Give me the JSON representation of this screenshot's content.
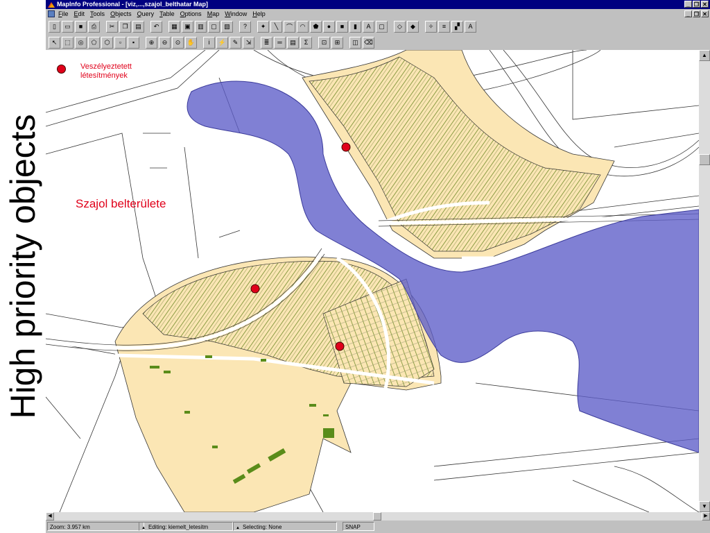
{
  "slide": {
    "side_text": "High priority objects"
  },
  "window": {
    "title": "MapInfo Professional - [viz,...,szajol_belthatar Map]",
    "controls": [
      "_",
      "❐",
      "✕"
    ]
  },
  "menu": [
    "File",
    "Edit",
    "Tools",
    "Objects",
    "Query",
    "Table",
    "Options",
    "Map",
    "Window",
    "Help"
  ],
  "toolbar1": [
    "new-icon",
    "open-icon",
    "save-icon",
    "print-icon",
    "cut-icon",
    "copy-icon",
    "paste-icon",
    "undo-icon",
    "browser-icon",
    "map-icon",
    "graph-icon",
    "layout-icon",
    "redistrict-icon",
    "help-icon",
    "symbol-icon",
    "line-icon",
    "polyline-icon",
    "arc-icon",
    "polygon-icon",
    "ellipse-icon",
    "rectangle-icon",
    "rounded-rect-icon",
    "text-icon",
    "frame-icon",
    "reshape-icon",
    "add-node-icon",
    "symbol-style-icon",
    "line-style-icon",
    "region-style-icon",
    "text-style-icon"
  ],
  "toolbar2": [
    "select-icon",
    "marquee-icon",
    "radius-icon",
    "polygon-select-icon",
    "boundary-select-icon",
    "unselect-icon",
    "graph-select-icon",
    "zoom-in-icon",
    "zoom-out-icon",
    "change-view-icon",
    "grabber-icon",
    "info-icon",
    "hotlink-icon",
    "label-icon",
    "drag-window-icon",
    "layer-control-icon",
    "ruler-icon",
    "legend-icon",
    "statistics-icon",
    "clip-icon",
    "set-target-icon",
    "split-icon",
    "erase-icon"
  ],
  "map": {
    "legend_label": "Veszélyeztetett létesítmények",
    "area_label": "Szajol belterülete",
    "colors": {
      "flood": "#5c5cc8",
      "urban": "#fbe6b4",
      "parcels": "#5a8c1a",
      "points": "#e0001a"
    }
  },
  "status": {
    "zoom": "Zoom: 3.957 km",
    "editing": "Editing: kiemelt_letesitm",
    "selecting": "Selecting: None",
    "snap": "SNAP"
  }
}
